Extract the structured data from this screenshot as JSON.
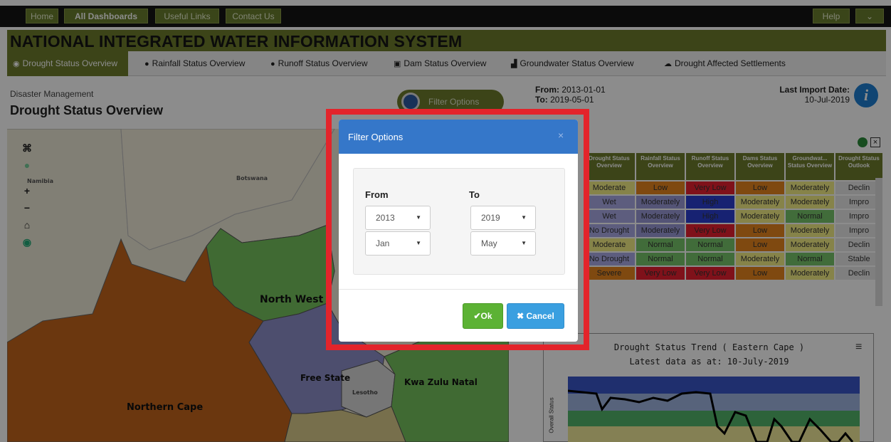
{
  "topnav": {
    "home": "Home",
    "all_dashboards": "All Dashboards",
    "useful_links": "Useful Links",
    "contact_us": "Contact Us",
    "help": "Help",
    "dropdown": "⌄"
  },
  "app_title": "NATIONAL INTEGRATED WATER INFORMATION SYSTEM",
  "tabs": [
    {
      "label": "Drought Status Overview",
      "icon": "globe-icon"
    },
    {
      "label": "Rainfall Status Overview",
      "icon": "droplet-icon"
    },
    {
      "label": "Runoff Status Overview",
      "icon": "circle-icon"
    },
    {
      "label": "Dam Status Overview",
      "icon": "dam-icon"
    },
    {
      "label": "Groundwater Status Overview",
      "icon": "bar-chart-icon"
    },
    {
      "label": "Drought Affected Settlements",
      "icon": "cloud-icon"
    }
  ],
  "header": {
    "breadcrumb": "Disaster Management",
    "page_title": "Drought Status Overview",
    "filter_button": "Filter Options",
    "from_label": "From:",
    "from_value": "2013-01-01",
    "to_label": "To:",
    "to_value": "2019-05-01",
    "last_import_label": "Last Import Date:",
    "last_import_value": "10-Jul-2019"
  },
  "map": {
    "labels": {
      "namibia": "Namibia",
      "botswana": "Botswana",
      "north_west": "North West",
      "free_state": "Free State",
      "lesotho": "Lesotho",
      "kwa_zulu_natal": "Kwa Zulu Natal",
      "northern_cape": "Northern Cape"
    },
    "colors": {
      "background": "#ece7d6",
      "northern_cape": "#c4641d",
      "north_west": "#75c25d",
      "free_state": "#8d8fc8",
      "kzn": "#75c25d",
      "lesotho": "#d8d8d8"
    }
  },
  "table": {
    "headers": [
      "Drought Status Overview",
      "Rainfall Status Overview",
      "Runoff Status Overview",
      "Dams Status Overview",
      "Groundwat... Status Overview",
      "Drought Status Outlook"
    ],
    "rows": [
      [
        "Moderate",
        "Low",
        "Very Low",
        "Low",
        "Moderately",
        "Declin"
      ],
      [
        "Wet",
        "Moderately",
        "High",
        "Moderately",
        "Moderately",
        "Impro"
      ],
      [
        "Wet",
        "Moderately",
        "High",
        "Moderately",
        "Normal",
        "Impro"
      ],
      [
        "No Drought",
        "Moderately",
        "Very Low",
        "Low",
        "Moderately",
        "Impro"
      ],
      [
        "Moderate",
        "Normal",
        "Normal",
        "Low",
        "Moderately",
        "Declin"
      ],
      [
        "No Drought",
        "Normal",
        "Normal",
        "Moderately",
        "Normal",
        "Stable"
      ],
      [
        "Severe",
        "Very Low",
        "Very Low",
        "Low",
        "Moderately",
        "Declin"
      ]
    ]
  },
  "trend": {
    "title": "Drought Status Trend ( Eastern Cape )",
    "subtitle": "Latest data as at: 10-July-2019",
    "ylabel": "Overall Status",
    "menu": "≡"
  },
  "modal": {
    "title": "Filter Options",
    "close": "×",
    "from_label": "From",
    "to_label": "To",
    "from_year": "2013",
    "from_month": "Jan",
    "to_year": "2019",
    "to_month": "May",
    "ok_label": "Ok",
    "cancel_label": "Cancel",
    "ok_icon": "✔",
    "cancel_icon": "✖"
  }
}
